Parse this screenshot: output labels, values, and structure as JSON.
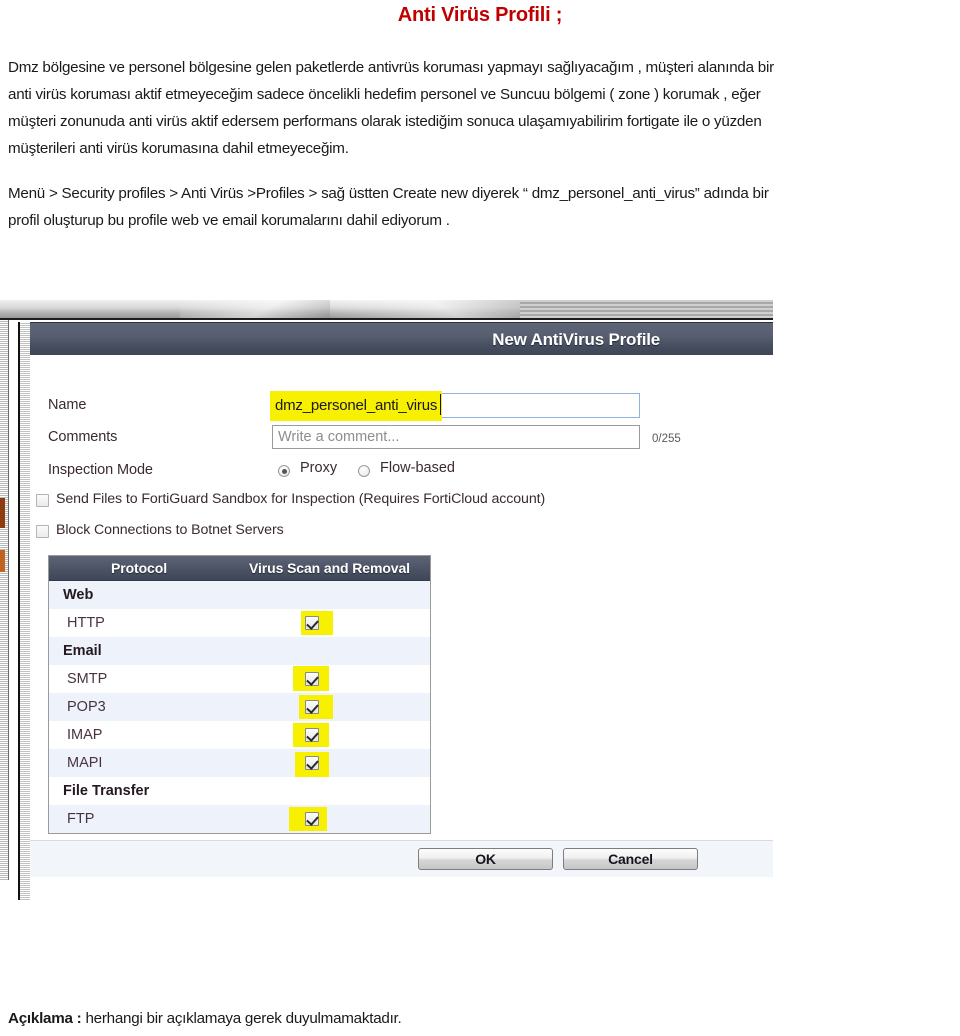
{
  "document": {
    "title": "Anti Virüs Profili ;",
    "title_color": "#C00000",
    "paragraphs": [
      "Dmz bölgesine ve personel  bölgesine gelen paketlerde antivrüs koruması yapmayı  sağlıyacağım , müşteri alanında bir",
      "anti virüs koruması aktif etmeyeceğim sadece öncelikli hedefim personel  ve Suncuu bölgemi ( zone )  korumak , eğer",
      "müşteri zonunuda anti virüs  aktif edersem  performans  olarak istediğim sonuca ulaşamıyabilirim fortigate ile o yüzden",
      "müşterileri anti virüs korumasına  dahil etmeyeceğim."
    ],
    "paragraphs2": [
      "Menü > Security profiles > Anti Virüs >Profiles >  sağ üstten Create new diyerek “ dmz_personel_anti_virus” adında bir",
      "profil oluşturup bu profile web  ve email korumalarını dahil ediyorum ."
    ],
    "footer_label": "Açıklama :",
    "footer_text": " herhangi bir açıklamaya  gerek duyulmamaktadır."
  },
  "dialog": {
    "title": "New AntiVirus Profile",
    "title_bg": "#4b5365",
    "fields": {
      "name_label": "Name",
      "name_value": "dmz_personel_anti_virus",
      "comments_label": "Comments",
      "comments_placeholder": "Write a comment...",
      "comments_counter": "0/255",
      "inspection_label": "Inspection Mode"
    },
    "radios": [
      {
        "label": "Proxy",
        "checked": true
      },
      {
        "label": "Flow-based",
        "checked": false
      }
    ],
    "checkboxes": [
      {
        "label": "Send Files to FortiGuard Sandbox for Inspection (Requires FortiCloud account)",
        "checked": false
      },
      {
        "label": "Block Connections to Botnet Servers",
        "checked": false
      }
    ],
    "table": {
      "headers": [
        "Protocol",
        "Virus Scan and Removal"
      ],
      "rows": [
        {
          "name": "Web",
          "group": true,
          "checked": false,
          "highlight": false
        },
        {
          "name": "HTTP",
          "group": false,
          "checked": true,
          "highlight": true
        },
        {
          "name": "Email",
          "group": true,
          "checked": false,
          "highlight": false
        },
        {
          "name": "SMTP",
          "group": false,
          "checked": true,
          "highlight": true
        },
        {
          "name": "POP3",
          "group": false,
          "checked": true,
          "highlight": true
        },
        {
          "name": "IMAP",
          "group": false,
          "checked": true,
          "highlight": true
        },
        {
          "name": "MAPI",
          "group": false,
          "checked": true,
          "highlight": true
        },
        {
          "name": "File Transfer",
          "group": true,
          "checked": false,
          "highlight": false
        },
        {
          "name": "FTP",
          "group": false,
          "checked": true,
          "highlight": true
        }
      ]
    },
    "buttons": {
      "ok": "OK",
      "cancel": "Cancel"
    },
    "highlight_color": "#F7F000"
  }
}
